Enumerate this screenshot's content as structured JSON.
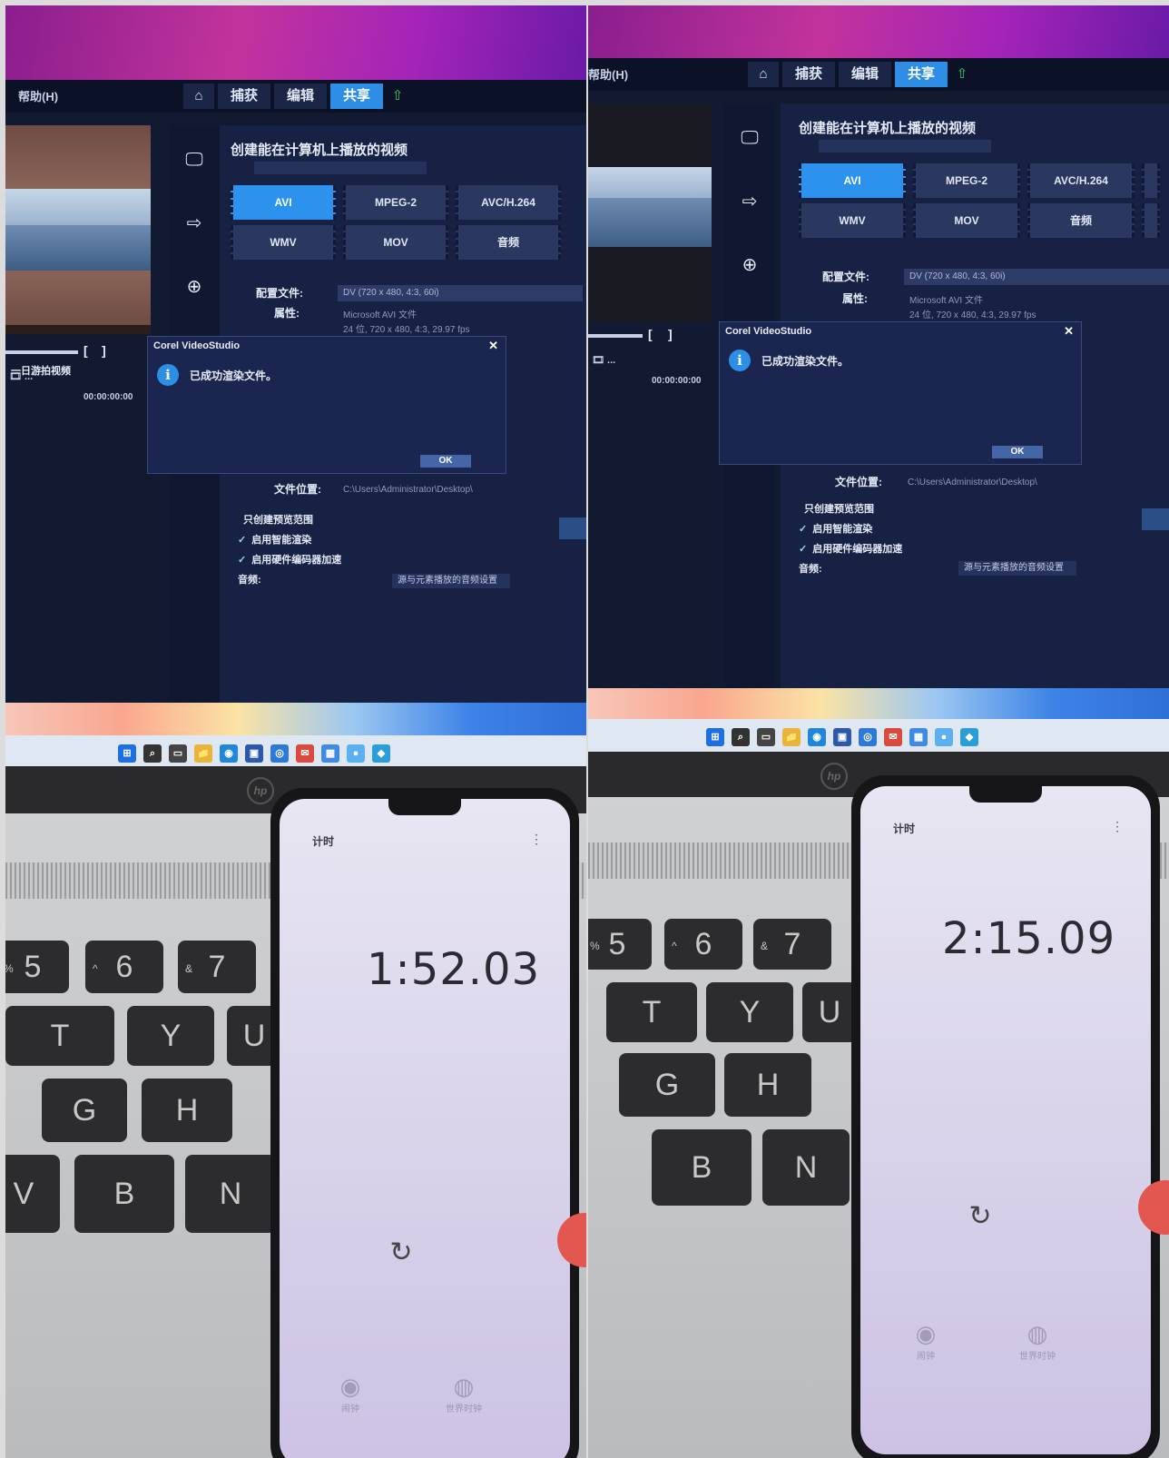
{
  "photos": [
    {
      "app": {
        "title": "帮助(H)",
        "nav": {
          "home": "⌂",
          "capture": "捕获",
          "edit": "编辑",
          "share": "共享",
          "upload": "⇧"
        }
      },
      "preview_caption": "一日游拍视频",
      "panel": {
        "title": "创建能在计算机上播放的视频",
        "formats": [
          "AVI",
          "MPEG-2",
          "AVC/H.264",
          "WMV",
          "MOV",
          "音频"
        ],
        "selected_format": "AVI",
        "profile_label": "配置文件:",
        "profile_value": "DV (720 x 480, 4:3, 60i)",
        "properties_label": "属性:",
        "properties_line1": "Microsoft AVI 文件",
        "properties_line2": "24 位, 720 x 480, 4:3, 29.97 fps",
        "file_location_label": "文件位置:",
        "file_location_value": "C:\\Users\\Administrator\\Desktop\\",
        "checks": [
          {
            "mark": "",
            "label": "只创建预览范围"
          },
          {
            "mark": "✓",
            "label": "启用智能渲染"
          },
          {
            "mark": "✓",
            "label": "启用硬件编码器加速"
          }
        ],
        "sound_label": "音频:",
        "sound_value": "源与元素播放的音频设置"
      },
      "timeline": {
        "bracket_open": "[",
        "bracket_close": "]",
        "label": "🎞 ...",
        "counter": "00:00:00:00"
      },
      "dialog": {
        "title": "Corel VideoStudio",
        "close": "✕",
        "info_icon": "i",
        "message": "已成功渲染文件。",
        "ok": "OK"
      },
      "taskbar_icons": [
        "⊞",
        "⌕",
        "▭",
        "📁",
        "◉",
        "▣",
        "◎",
        "✉",
        "▦",
        "●",
        "◆"
      ],
      "laptop": {
        "logo": "hp"
      },
      "phone": {
        "header": "计时",
        "menu": "⋮",
        "time": "1:52.03",
        "reset_icon": "↻",
        "nav": [
          {
            "icon": "◉",
            "label": "闹钟"
          },
          {
            "icon": "◍",
            "label": "世界时钟"
          }
        ]
      },
      "keys": [
        {
          "main": "5",
          "sub": "%"
        },
        {
          "main": "6",
          "sub": "^"
        },
        {
          "main": "7",
          "sub": "&"
        },
        {
          "main": "T",
          "sub": ""
        },
        {
          "main": "Y",
          "sub": ""
        },
        {
          "main": "U",
          "sub": ""
        },
        {
          "main": "G",
          "sub": ""
        },
        {
          "main": "H",
          "sub": ""
        },
        {
          "main": "V",
          "sub": ""
        },
        {
          "main": "B",
          "sub": ""
        },
        {
          "main": "N",
          "sub": ""
        }
      ]
    },
    {
      "app": {
        "title": "帮助(H)",
        "nav": {
          "home": "⌂",
          "capture": "捕获",
          "edit": "编辑",
          "share": "共享",
          "upload": "⇧"
        }
      },
      "panel": {
        "title": "创建能在计算机上播放的视频",
        "formats": [
          "AVI",
          "MPEG-2",
          "AVC/H.264",
          "WMV",
          "MOV",
          "音频"
        ],
        "selected_format": "AVI",
        "profile_label": "配置文件:",
        "profile_value": "DV (720 x 480, 4:3, 60i)",
        "properties_label": "属性:",
        "properties_line1": "Microsoft AVI 文件",
        "properties_line2": "24 位, 720 x 480, 4:3, 29.97 fps",
        "file_location_label": "文件位置:",
        "file_location_value": "C:\\Users\\Administrator\\Desktop\\",
        "checks": [
          {
            "mark": "",
            "label": "只创建预览范围"
          },
          {
            "mark": "✓",
            "label": "启用智能渲染"
          },
          {
            "mark": "✓",
            "label": "启用硬件编码器加速"
          }
        ],
        "sound_label": "音频:",
        "sound_value": "源与元素播放的音频设置"
      },
      "timeline": {
        "bracket_open": "[",
        "bracket_close": "]",
        "label": "🎞 ...",
        "counter": "00:00:00:00"
      },
      "dialog": {
        "title": "Corel VideoStudio",
        "close": "✕",
        "info_icon": "i",
        "message": "已成功渲染文件。",
        "ok": "OK"
      },
      "taskbar_icons": [
        "⊞",
        "⌕",
        "▭",
        "📁",
        "◉",
        "▣",
        "◎",
        "✉",
        "▦",
        "●",
        "◆"
      ],
      "laptop": {
        "logo": "hp"
      },
      "phone": {
        "header": "计时",
        "menu": "⋮",
        "time": "2:15.09",
        "reset_icon": "↻",
        "nav": [
          {
            "icon": "◉",
            "label": "闹钟"
          },
          {
            "icon": "◍",
            "label": "世界时钟"
          }
        ]
      },
      "keys": [
        {
          "main": "5",
          "sub": "%"
        },
        {
          "main": "6",
          "sub": "^"
        },
        {
          "main": "7",
          "sub": "&"
        },
        {
          "main": "T",
          "sub": ""
        },
        {
          "main": "Y",
          "sub": ""
        },
        {
          "main": "U",
          "sub": ""
        },
        {
          "main": "G",
          "sub": ""
        },
        {
          "main": "H",
          "sub": ""
        },
        {
          "main": "B",
          "sub": ""
        },
        {
          "main": "N",
          "sub": ""
        }
      ]
    }
  ],
  "colors": {
    "accent": "#2c92ee",
    "panel": "#162143",
    "start_button": "#e2574f",
    "taskbar_icon_palette": [
      "#1f6fe0",
      "#333333",
      "#444444",
      "#e8b43a",
      "#1f86d8",
      "#2d5aa8",
      "#2f79d6",
      "#d94a3c",
      "#3f8be2",
      "#5cb0f0",
      "#2b9ed8"
    ]
  }
}
